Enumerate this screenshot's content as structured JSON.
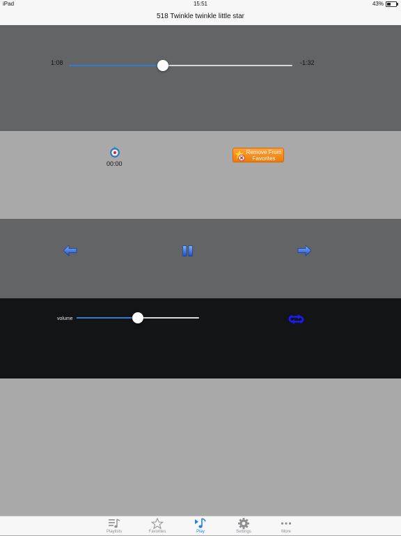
{
  "status_bar": {
    "device": "iPad",
    "time": "15:51",
    "battery": "43%",
    "battery_level": 0.43
  },
  "nav": {
    "title": "518 Twinkle twinkle little star"
  },
  "progress": {
    "elapsed": "1:08",
    "remaining": "-1:32",
    "fraction": 0.42
  },
  "timer": {
    "value": "00:00",
    "icon": "stopwatch-icon"
  },
  "favorites_button": {
    "label": "Remove From Favorites",
    "line1": "Remove From",
    "line2": "Favorites"
  },
  "transport": {
    "previous_icon": "previous-arrow-icon",
    "pause_icon": "pause-icon",
    "next_icon": "next-arrow-icon"
  },
  "volume": {
    "label": "volume",
    "level": 0.5,
    "repeat_icon": "repeat-icon"
  },
  "tab_bar": {
    "items": [
      {
        "label": "Playlists",
        "icon": "playlist-icon"
      },
      {
        "label": "Favorites",
        "icon": "star-icon"
      },
      {
        "label": "Play",
        "icon": "music-note-icon",
        "active": true
      },
      {
        "label": "Settings",
        "icon": "gear-icon"
      },
      {
        "label": "More",
        "icon": "more-icon"
      }
    ]
  },
  "colors": {
    "accent": "#1e7ef0",
    "slider_fill": "#2f7bd8",
    "favorite_orange": "#f07b06",
    "repeat_blue": "#1a1aff"
  }
}
